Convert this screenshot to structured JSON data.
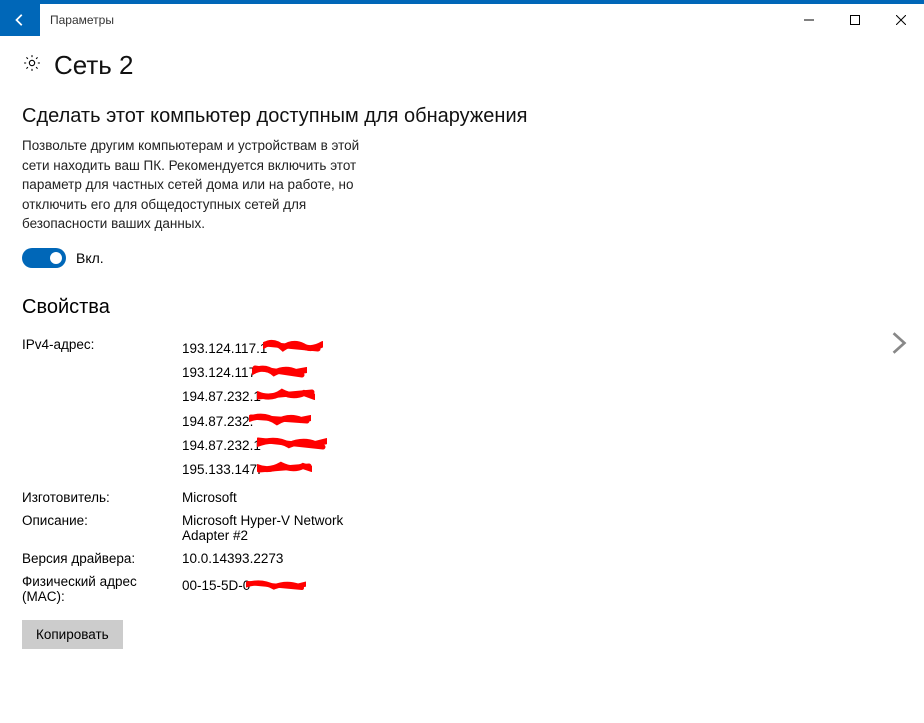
{
  "header": {
    "title": "Параметры"
  },
  "page": {
    "title": "Сеть  2"
  },
  "discoverable": {
    "heading": "Сделать этот компьютер доступным для обнаружения",
    "description": "Позвольте другим компьютерам и устройствам в этой сети находить ваш ПК. Рекомендуется включить этот параметр для частных сетей дома или на работе, но отключить его для общедоступных сетей для безопасности ваших данных.",
    "toggle_on": true,
    "toggle_state": "Вкл."
  },
  "properties": {
    "heading": "Свойства",
    "rows": [
      {
        "label": "IPv4-адрес:",
        "values": [
          "193.124.117.1",
          "193.124.117",
          "194.87.232.1",
          "194.87.232.",
          "194.87.232.1",
          "195.133.147."
        ],
        "values_redacted": true
      },
      {
        "label": "Изготовитель:",
        "value": "Microsoft"
      },
      {
        "label": "Описание:",
        "value": "Microsoft Hyper-V Network Adapter #2"
      },
      {
        "label": "Версия драйвера:",
        "value": "10.0.14393.2273"
      },
      {
        "label": "Физический адрес (MAC):",
        "value": "00-15-5D-0",
        "value_redacted": true
      }
    ],
    "copy_label": "Копировать"
  }
}
